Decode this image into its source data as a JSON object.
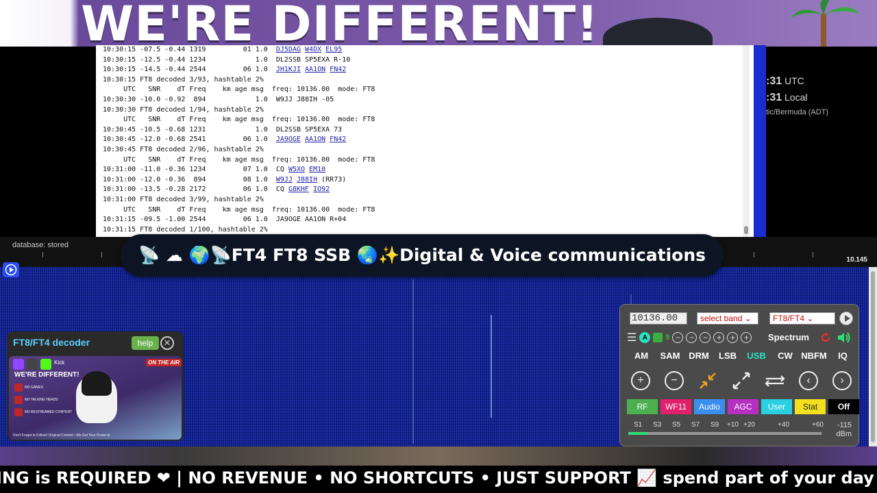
{
  "top_banner": {
    "headline": "WE'RE DIFFERENT!"
  },
  "log": {
    "lines": [
      {
        "t": "10:30:15 -07.5 -0.44 1319         01 1.0  ",
        "c": [
          "DJ5DAG",
          "W4DX",
          "EL95"
        ]
      },
      {
        "t": "10:30:15 -12.5 -0.44 1234            1.0  DL2SSB SP5EXA R-10",
        "c": []
      },
      {
        "t": "10:30:15 -14.5 -0.44 2544         06 1.0  ",
        "c": [
          "JH1KJI",
          "AA1ON",
          "FN42"
        ]
      },
      {
        "t": "10:30:15 FT8 decoded 3/93, hashtable 2%",
        "c": []
      },
      {
        "t": "     UTC   SNR    dT Freq    km age msg  freq: 10136.00  mode: FT8",
        "c": []
      },
      {
        "t": "10:30:30 -10.0 -0.92  894            1.0  W9JJ J88IH -05",
        "c": []
      },
      {
        "t": "10:30:30 FT8 decoded 1/94, hashtable 2%",
        "c": []
      },
      {
        "t": "     UTC   SNR    dT Freq    km age msg  freq: 10136.00  mode: FT8",
        "c": []
      },
      {
        "t": "10:30:45 -10.5 -0.68 1231            1.0  DL2SSB SP5EXA 73",
        "c": []
      },
      {
        "t": "10:30:45 -12.0 -0.68 2541         06 1.0  ",
        "c": [
          "JA9OGE",
          "AA1ON",
          "FN42"
        ]
      },
      {
        "t": "10:30:45 FT8 decoded 2/96, hashtable 2%",
        "c": []
      },
      {
        "t": "     UTC   SNR    dT Freq    km age msg  freq: 10136.00  mode: FT8",
        "c": []
      },
      {
        "t": "10:31:00 -11.0 -0.36 1234         07 1.0  CQ ",
        "c": [
          "W5XO",
          "EM10"
        ]
      },
      {
        "t": "10:31:00 -12.0 -0.36  894         08 1.0  ",
        "c": [
          "W9JJ",
          "J88IH"
        ],
        "tail": " (RR73)"
      },
      {
        "t": "10:31:00 -13.5 -0.28 2172         06 1.0  CQ ",
        "c": [
          "G8KHF",
          "IO92"
        ]
      },
      {
        "t": "10:31:00 FT8 decoded 3/99, hashtable 2%",
        "c": []
      },
      {
        "t": "     UTC   SNR    dT Freq    km age msg  freq: 10136.00  mode: FT8",
        "c": []
      },
      {
        "t": "10:31:15 -09.5 -1.00 2544         06 1.0  JA9OGE AA1ON R+04",
        "c": []
      },
      {
        "t": "10:31:15 FT8 decoded 1/100, hashtable 2%",
        "c": []
      }
    ]
  },
  "clock": {
    "utc_time": ":31",
    "utc_label": "UTC",
    "local_time": ":31",
    "local_label": "Local",
    "timezone": "tic/Bermuda (ADT)"
  },
  "scale": {
    "db_status": "database: stored",
    "freq_right": "10.145"
  },
  "mode_banner": "📡 ☁ 🌍📡FT4 FT8 SSB 🌏✨Digital & Voice communications",
  "decoder": {
    "title": "FT8/FT4 decoder",
    "help": "help",
    "close": "✕",
    "promo": {
      "kick": "Kick",
      "on_air": "ON THE AIR",
      "headline": "WE'RE DIFFERENT!",
      "rules": [
        "NO GAMES",
        "NO TALKING HEADS",
        "NO RESTREAMED CONTENT"
      ],
      "footer": "Don't Forget to Follow! Original Content • We Got Your Power at"
    }
  },
  "control": {
    "frequency": "10136.00",
    "band": "select band",
    "mode": "FT8/FT4",
    "spectrum": "Spectrum",
    "a_label": "A",
    "nine_label": "9",
    "modes": [
      "AM",
      "SAM",
      "DRM",
      "LSB",
      "USB",
      "CW",
      "NBFM",
      "IQ"
    ],
    "active_mode": "USB",
    "tabs": [
      {
        "label": "RF",
        "bg": "#4caf50",
        "fg": "#fff"
      },
      {
        "label": "WF11",
        "bg": "#e0206a",
        "fg": "#fff"
      },
      {
        "label": "Audio",
        "bg": "#3a8ef0",
        "fg": "#fff"
      },
      {
        "label": "AGC",
        "bg": "#b52fc0",
        "fg": "#fff"
      },
      {
        "label": "User",
        "bg": "#2ad0e0",
        "fg": "#fff"
      },
      {
        "label": "Stat",
        "bg": "#f2e020",
        "fg": "#222"
      },
      {
        "label": "Off",
        "bg": "#000",
        "fg": "#fff"
      }
    ],
    "smeter": {
      "labels": [
        "S1",
        "S3",
        "S5",
        "S7",
        "S9",
        "+10",
        "+20",
        "+40",
        "+60"
      ],
      "value": "-115",
      "unit": "dBm",
      "level_fraction": 0.1
    }
  },
  "ticker": "ING is REQUIRED ❤ | NO REVENUE • NO SHORTCUTS • JUST SUPPORT 📈 spend part of your day w"
}
